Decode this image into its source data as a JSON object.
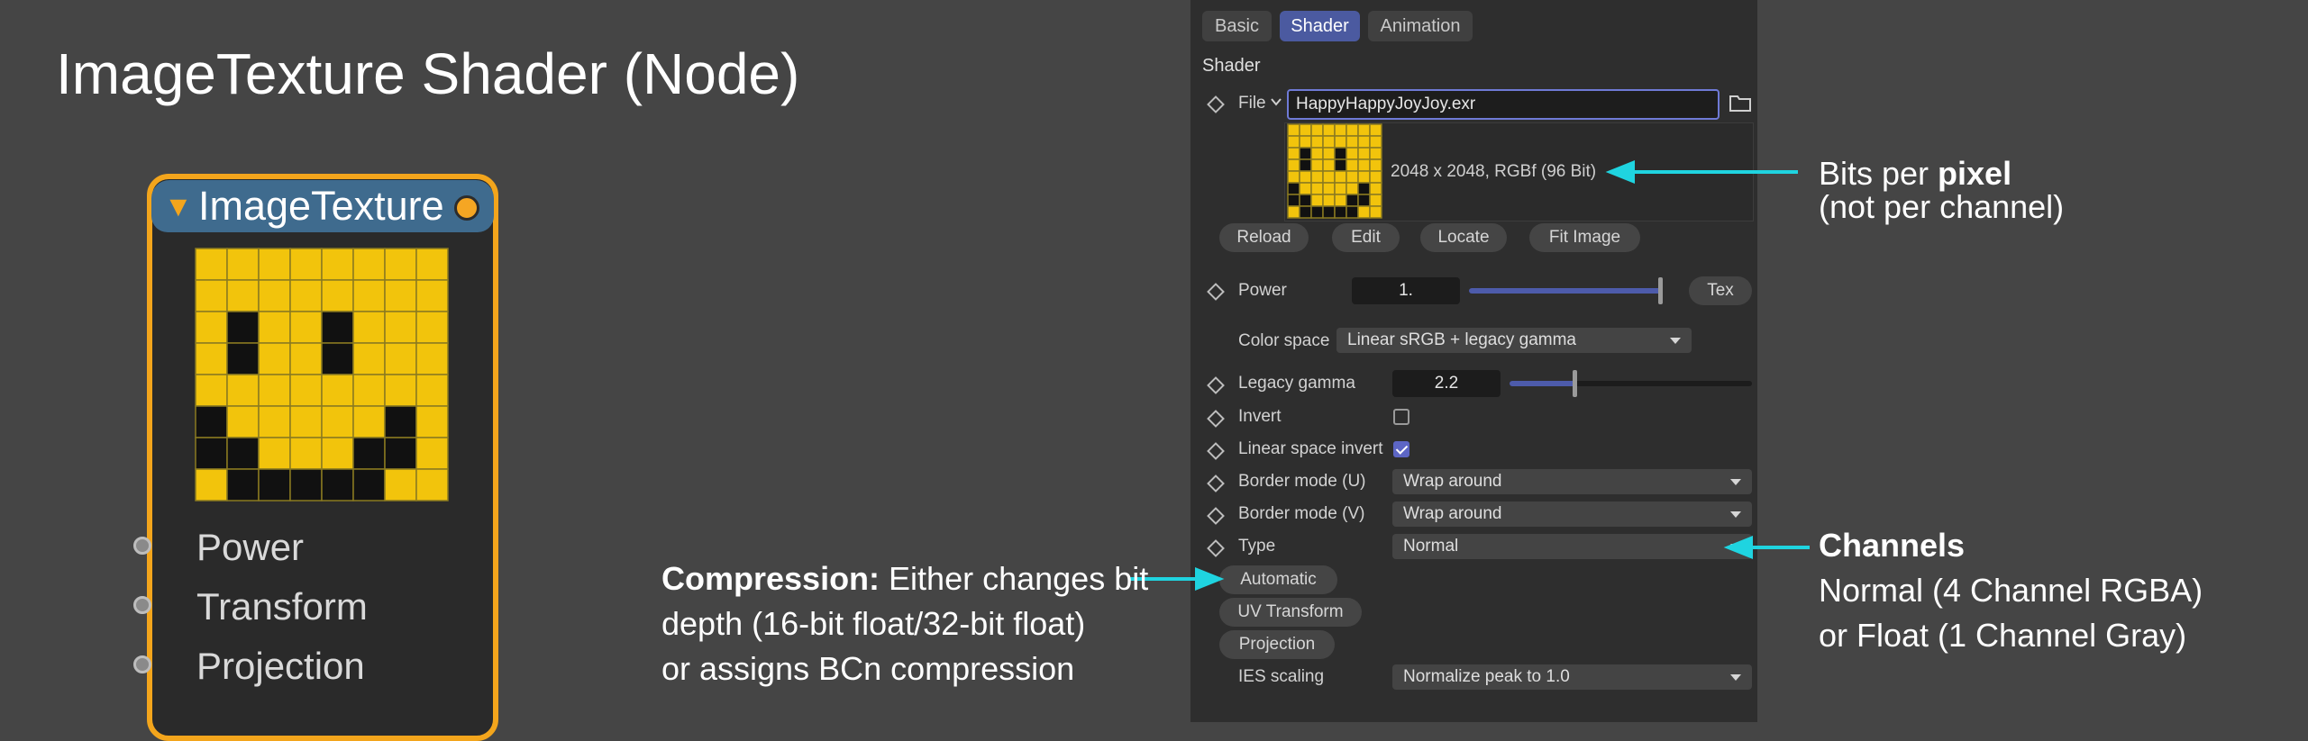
{
  "title": "ImageTexture Shader (Node)",
  "node": {
    "name": "ImageTexture",
    "inputs": [
      "Power",
      "Transform",
      "Projection"
    ],
    "colors": {
      "border": "#f3a51c",
      "header": "#3f6b8e",
      "body": "#2a2a2a"
    }
  },
  "panel": {
    "tabs": [
      {
        "label": "Basic",
        "active": false
      },
      {
        "label": "Shader",
        "active": true
      },
      {
        "label": "Animation",
        "active": false
      }
    ],
    "section": "Shader",
    "file": {
      "label": "File",
      "value": "HappyHappyJoyJoy.exr",
      "info": "2048 x 2048, RGBf (96 Bit)"
    },
    "buttons": {
      "reload": "Reload",
      "edit": "Edit",
      "locate": "Locate",
      "fit_image": "Fit Image"
    },
    "power": {
      "label": "Power",
      "value": "1.",
      "fill_fraction": 1.0,
      "tex_button": "Tex"
    },
    "color_space": {
      "label": "Color space",
      "value": "Linear sRGB + legacy gamma"
    },
    "legacy_gamma": {
      "label": "Legacy gamma",
      "value": "2.2",
      "fill_fraction": 0.27
    },
    "invert": {
      "label": "Invert",
      "checked": false
    },
    "linear_space_invert": {
      "label": "Linear space invert",
      "checked": true
    },
    "border_mode_u": {
      "label": "Border mode (U)",
      "value": "Wrap around"
    },
    "border_mode_v": {
      "label": "Border mode (V)",
      "value": "Wrap around"
    },
    "type": {
      "label": "Type",
      "value": "Normal"
    },
    "compression_button": "Automatic",
    "uv_transform_button": "UV Transform",
    "projection_button": "Projection",
    "ies_scaling": {
      "label": "IES scaling",
      "value": "Normalize peak to 1.0"
    },
    "accent_color": "#4b5aa0"
  },
  "annotations": {
    "bits": {
      "prefix": "Bits per ",
      "bold": "pixel",
      "line2": "(not per channel)"
    },
    "channels": {
      "heading": "Channels",
      "line1": "Normal (4 Channel RGBA)",
      "line2": "or Float (1 Channel Gray)"
    },
    "compression": {
      "bold": "Compression:",
      "line1_rest": " Either changes bit",
      "line2": "depth (16-bit float/32-bit float)",
      "line3": "or assigns BCn compression"
    },
    "arrow_color": "#1fd4e0"
  },
  "smiley": {
    "rows": [
      "00000000",
      "00000000",
      "01001000",
      "01001000",
      "00000000",
      "10000010",
      "11000110",
      "01111100"
    ],
    "colors": {
      "fill": "#f2c40c",
      "dark": "#111111",
      "grid": "#8a7a20"
    }
  }
}
